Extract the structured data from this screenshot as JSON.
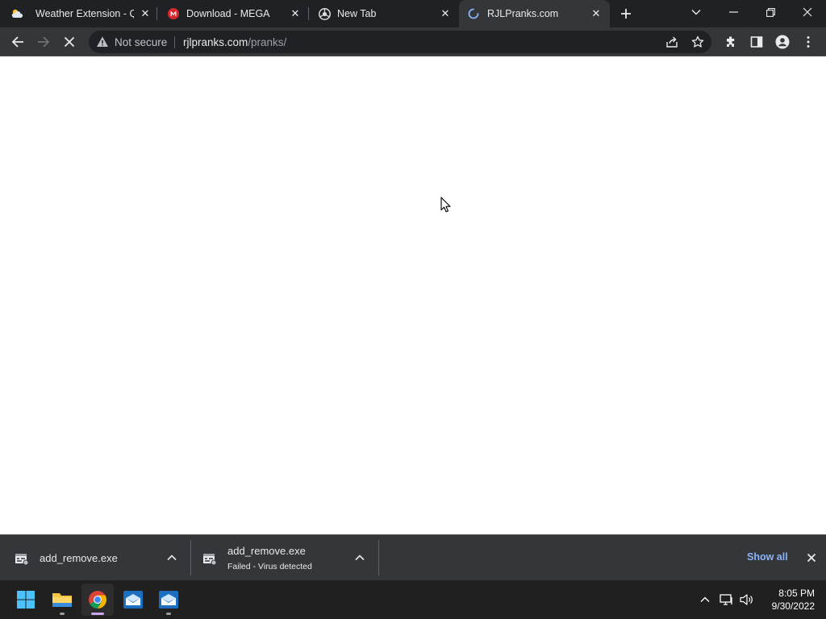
{
  "browser": {
    "tabs": [
      {
        "title": "Weather Extension - Qu",
        "favicon": "weather-favicon",
        "active": false
      },
      {
        "title": "Download - MEGA",
        "favicon": "mega-favicon",
        "active": false
      },
      {
        "title": "New Tab",
        "favicon": "chrome-favicon",
        "active": false
      },
      {
        "title": "RJLPranks.com",
        "favicon": "loading-spinner",
        "active": true
      }
    ],
    "omnibox": {
      "security_label": "Not secure",
      "url_host": "rjlpranks.com",
      "url_path": "/pranks/"
    }
  },
  "downloads": {
    "items": [
      {
        "filename": "add_remove.exe",
        "status": ""
      },
      {
        "filename": "add_remove.exe",
        "status": "Failed - Virus detected"
      }
    ],
    "show_all_label": "Show all"
  },
  "taskbar": {
    "apps": [
      "start-icon",
      "file-explorer-icon",
      "chrome-icon",
      "mail-app-icon",
      "mail-app-icon"
    ],
    "clock": {
      "time": "8:05 PM",
      "date": "9/30/2022"
    }
  },
  "colors": {
    "tab_strip": "#202124",
    "toolbar": "#35363a",
    "accent_link": "#8ab4f8",
    "taskbar": "#202020"
  }
}
